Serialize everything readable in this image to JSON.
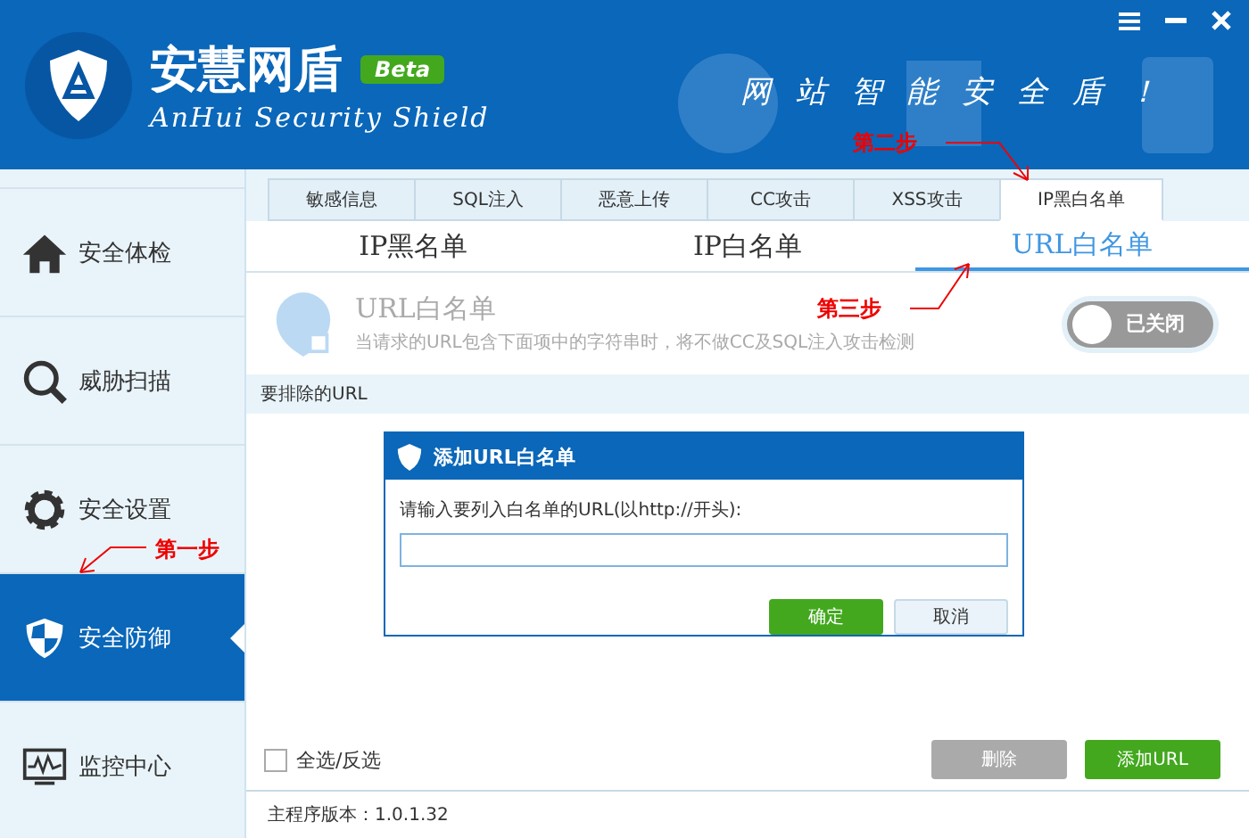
{
  "header": {
    "app_name": "安慧网盾",
    "badge": "Beta",
    "subtitle": "AnHui Security Shield",
    "slogan": "网站智能安全盾！"
  },
  "sidebar": {
    "items": [
      {
        "label": "安全体检",
        "kind": "house",
        "selected": false
      },
      {
        "label": "威胁扫描",
        "kind": "search",
        "selected": false
      },
      {
        "label": "安全设置",
        "kind": "gear",
        "selected": false
      },
      {
        "label": "安全防御",
        "kind": "shield",
        "selected": true
      },
      {
        "label": "监控中心",
        "kind": "monitor",
        "selected": false
      }
    ]
  },
  "tabs": [
    {
      "label": "敏感信息",
      "selected": false
    },
    {
      "label": "SQL注入",
      "selected": false
    },
    {
      "label": "恶意上传",
      "selected": false
    },
    {
      "label": "CC攻击",
      "selected": false
    },
    {
      "label": "XSS攻击",
      "selected": false
    },
    {
      "label": "IP黑白名单",
      "selected": true
    }
  ],
  "subtabs": [
    {
      "label": "IP黑名单",
      "selected": false
    },
    {
      "label": "IP白名单",
      "selected": false
    },
    {
      "label": "URL白名单",
      "selected": true
    }
  ],
  "section": {
    "title": "URL白名单",
    "description": "当请求的URL包含下面项中的字符串时，将不做CC及SQL注入攻击检测",
    "toggle": {
      "label": "已关闭",
      "on": false
    }
  },
  "list": {
    "heading": "要排除的URL"
  },
  "dialog": {
    "title": "添加URL白名单",
    "prompt": "请输入要列入白名单的URL(以http://开头):",
    "buttons": [
      {
        "label": "确定",
        "kind": "primary"
      },
      {
        "label": "取消",
        "kind": "secondary"
      }
    ]
  },
  "footer_bar": {
    "select_all": {
      "label": "全选/反选",
      "checked": false
    },
    "delete": {
      "label": "删除",
      "disabled": true
    },
    "add": {
      "label": "添加URL",
      "disabled": false
    }
  },
  "status_bar": {
    "version": "主程序版本：1.0.1.32"
  },
  "annotations": [
    {
      "label": "第二步",
      "kind": "tab"
    },
    {
      "label": "第三步",
      "kind": "subtab"
    },
    {
      "label": "第一步",
      "kind": "sidebar"
    }
  ]
}
